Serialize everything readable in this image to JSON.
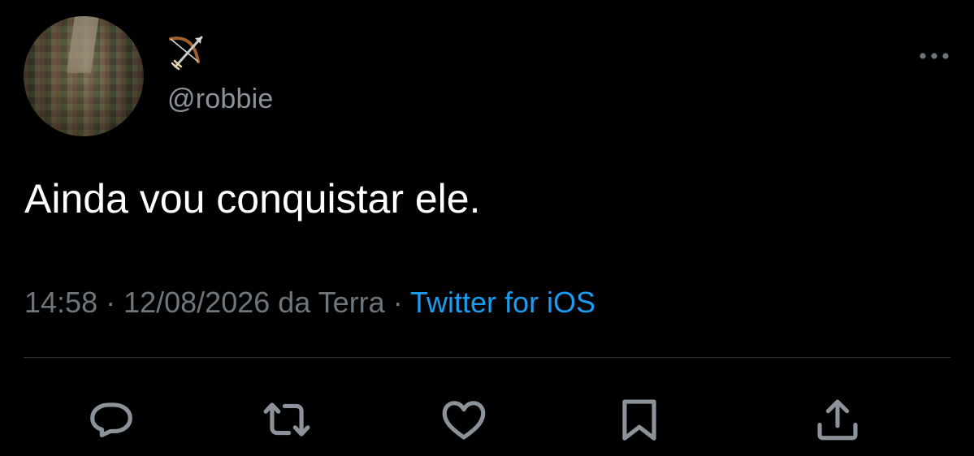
{
  "tweet": {
    "author": {
      "display_name_icon": "bow-and-arrow-icon",
      "handle": "@robbie",
      "avatar": "avatar-photo"
    },
    "text": "Ainda vou conquistar ele.",
    "meta": {
      "time": "14:58",
      "separator1": " · ",
      "date_location": "12/08/2026 da Terra",
      "separator2": " · ",
      "source": "Twitter for iOS"
    },
    "more_icon": "more-horizontal-icon",
    "actions": [
      {
        "name": "reply",
        "icon": "reply-icon"
      },
      {
        "name": "retweet",
        "icon": "retweet-icon"
      },
      {
        "name": "like",
        "icon": "heart-icon"
      },
      {
        "name": "bookmark",
        "icon": "bookmark-icon"
      },
      {
        "name": "share",
        "icon": "share-icon"
      }
    ]
  },
  "colors": {
    "background": "#000000",
    "text": "#ffffff",
    "secondary": "#6e767d",
    "link": "#1d9bf0",
    "divider": "#2f3336"
  }
}
